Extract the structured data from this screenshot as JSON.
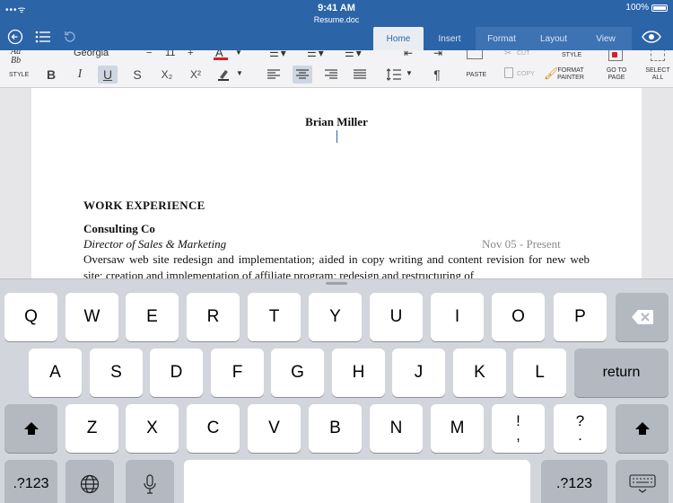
{
  "status": {
    "time": "9:41 AM",
    "battery": "100%",
    "signal": "•••ᯤ"
  },
  "document": {
    "file_name": "Resume.doc",
    "name": "Brian Miller",
    "section": "WORK EXPERIENCE",
    "company": "Consulting Co",
    "role": "Director of Sales & Marketing",
    "dates": "Nov 05 - Present",
    "description": "Oversaw web site redesign and implementation; aided in copy writing and content revision for new web site; creation and implementation of affiliate program; redesign and restructuring of"
  },
  "tabs": [
    {
      "label": "Home",
      "active": true
    },
    {
      "label": "Insert"
    },
    {
      "label": "Format"
    },
    {
      "label": "Layout"
    },
    {
      "label": "View"
    }
  ],
  "ribbon": {
    "style_preview": "Aa Bb",
    "style_label": "STYLE",
    "font_name": "Georgia",
    "font_size": "11",
    "bold": "B",
    "italic": "I",
    "underline": "U",
    "strike": "S",
    "subscript": "X₂",
    "superscript": "X²",
    "paste": "PASTE",
    "cut": "CUT",
    "copy": "COPY",
    "copy_style": "STYLE",
    "format_painter": "FORMAT PAINTER",
    "go_to_page": "GO TO PAGE",
    "select_all": "SELECT ALL"
  },
  "keyboard": {
    "row1": [
      "Q",
      "W",
      "E",
      "R",
      "T",
      "Y",
      "U",
      "I",
      "O",
      "P"
    ],
    "row2": [
      "A",
      "S",
      "D",
      "F",
      "G",
      "H",
      "J",
      "K",
      "L"
    ],
    "row3": [
      "Z",
      "X",
      "C",
      "V",
      "B",
      "N",
      "M"
    ],
    "return": "return",
    "numbers": ".?123",
    "excl_top": "!",
    "excl_bottom": ",",
    "quest_top": "?",
    "quest_bottom": "."
  },
  "colors": {
    "accent": "#2c64a8",
    "font_color_bar": "#d0232a"
  }
}
